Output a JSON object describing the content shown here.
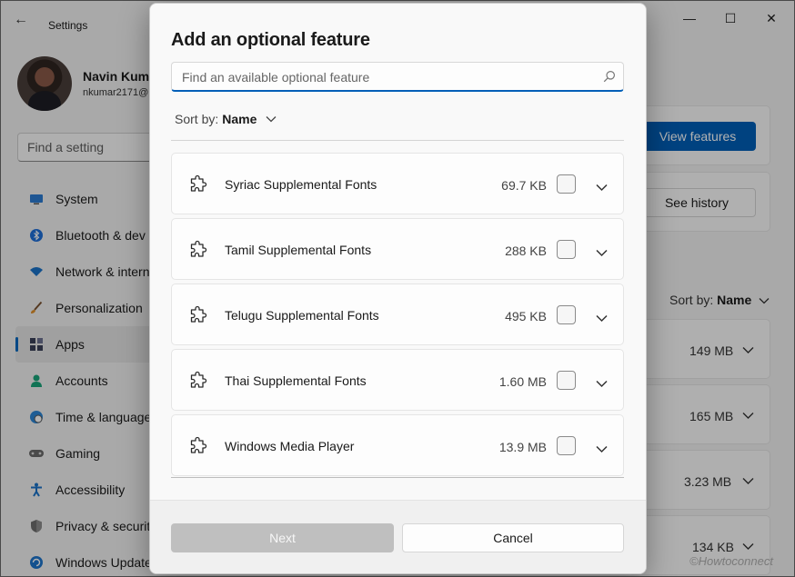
{
  "window": {
    "title": "Settings",
    "back_glyph": "←",
    "controls": {
      "minimize": "—",
      "maximize": "☐",
      "close": "✕"
    }
  },
  "profile": {
    "name": "Navin Kuma",
    "email": "nkumar2171@"
  },
  "search_settings": {
    "placeholder": "Find a setting"
  },
  "nav": {
    "items": [
      {
        "label": "System",
        "icon": "monitor-icon",
        "active": false
      },
      {
        "label": "Bluetooth & dev",
        "icon": "bluetooth-icon",
        "active": false
      },
      {
        "label": "Network & intern",
        "icon": "wifi-icon",
        "active": false
      },
      {
        "label": "Personalization",
        "icon": "brush-icon",
        "active": false
      },
      {
        "label": "Apps",
        "icon": "apps-icon",
        "active": true
      },
      {
        "label": "Accounts",
        "icon": "person-icon",
        "active": false
      },
      {
        "label": "Time & language",
        "icon": "globe-clock-icon",
        "active": false
      },
      {
        "label": "Gaming",
        "icon": "gamepad-icon",
        "active": false
      },
      {
        "label": "Accessibility",
        "icon": "accessibility-icon",
        "active": false
      },
      {
        "label": "Privacy & securit",
        "icon": "shield-icon",
        "active": false
      },
      {
        "label": "Windows Update",
        "icon": "update-icon",
        "active": false
      }
    ]
  },
  "background_main": {
    "view_features_label": "View features",
    "see_history_label": "See history",
    "sort_by_label": "Sort by:",
    "sort_by_value": "Name",
    "installed_sizes": [
      "149 MB",
      "165 MB",
      "3.23 MB",
      "134 KB"
    ]
  },
  "dialog": {
    "title": "Add an optional feature",
    "search_placeholder": "Find an available optional feature",
    "sort_by_label": "Sort by:",
    "sort_by_value": "Name",
    "features": [
      {
        "name": "Syriac Supplemental Fonts",
        "size": "69.7 KB",
        "checked": false,
        "icon": "puzzle-icon"
      },
      {
        "name": "Tamil Supplemental Fonts",
        "size": "288 KB",
        "checked": false,
        "icon": "puzzle-icon"
      },
      {
        "name": "Telugu Supplemental Fonts",
        "size": "495 KB",
        "checked": false,
        "icon": "puzzle-icon"
      },
      {
        "name": "Thai Supplemental Fonts",
        "size": "1.60 MB",
        "checked": false,
        "icon": "puzzle-icon"
      },
      {
        "name": "Windows Media Player",
        "size": "13.9 MB",
        "checked": false,
        "icon": "puzzle-icon"
      }
    ],
    "next_label": "Next",
    "cancel_label": "Cancel"
  },
  "watermark": "©Howtoconnect",
  "colors": {
    "accent": "#005fb8",
    "disabled_button": "#bfbfbf",
    "dialog_background": "#f9f9f9"
  }
}
